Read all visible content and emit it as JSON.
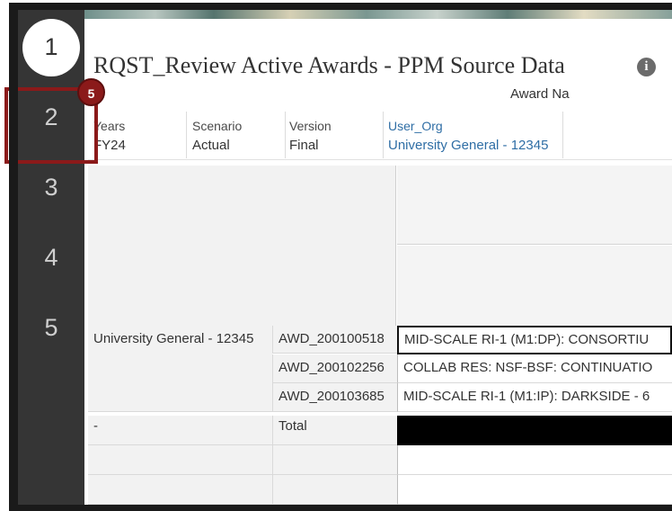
{
  "steps": [
    {
      "label": "1",
      "active": true
    },
    {
      "label": "2",
      "active": false
    },
    {
      "label": "3",
      "active": false
    },
    {
      "label": "4",
      "active": false
    },
    {
      "label": "5",
      "active": false
    }
  ],
  "page": {
    "title": "RQST_Review Active Awards - PPM Source Data",
    "info_icon": "i"
  },
  "pov": [
    {
      "label": "Years",
      "value": "FY24"
    },
    {
      "label": "Scenario",
      "value": "Actual"
    },
    {
      "label": "Version",
      "value": "Final"
    },
    {
      "label": "User_Org",
      "value": "University General - 12345"
    }
  ],
  "grid": {
    "column_header": "Award Na",
    "rows": [
      {
        "org": "University General - 12345",
        "award": "AWD_200100518",
        "name": "MID-SCALE RI-1 (M1:DP): CONSORTIU"
      },
      {
        "org": "",
        "award": "AWD_200102256",
        "name": "COLLAB RES: NSF-BSF: CONTINUATIO"
      },
      {
        "org": "",
        "award": "AWD_200103685",
        "name": "MID-SCALE RI-1 (M1:IP): DARKSIDE - 6"
      },
      {
        "org": "-",
        "award": "Total",
        "name": ""
      }
    ]
  },
  "callout": {
    "badge": "5"
  },
  "colors": {
    "sidebar": "#353535",
    "callout": "#8b1a1a",
    "link": "#2f6ea5"
  }
}
